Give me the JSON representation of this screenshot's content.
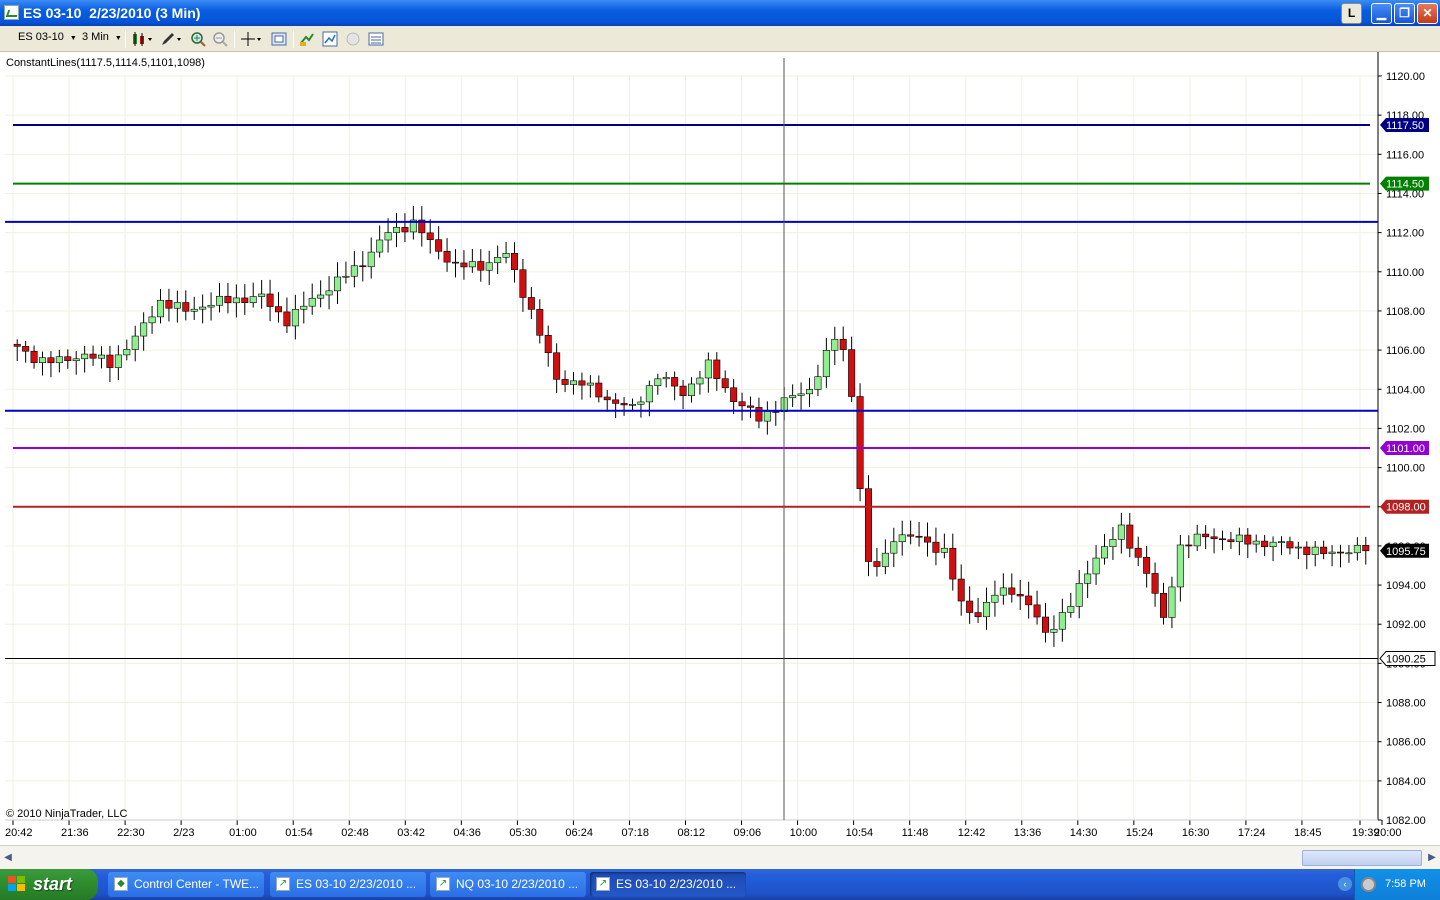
{
  "window": {
    "title": "ES 03-10  2/23/2010 (3 Min)",
    "buttons": {
      "layout": "L"
    }
  },
  "toolbar": {
    "instrument": "ES 03-10",
    "interval": "3 Min",
    "tools": [
      "candlestick-icon",
      "pencil-icon",
      "zoom-in-icon",
      "zoom-out-icon",
      "crosshair-icon",
      "properties-icon",
      "strategy-icon",
      "indicator-icon",
      "circle-icon",
      "data-box-icon"
    ]
  },
  "chart": {
    "indicator_label": "ConstantLines(1117.5,1114.5,1101,1098)",
    "copyright": "© 2010 NinjaTrader, LLC",
    "colors": {
      "up": "#90ee90",
      "down": "#d01010",
      "wick": "#000000"
    },
    "chart_data": {
      "type": "candlestick",
      "instrument": "ES 03-10",
      "interval": "3 Min",
      "ylim": [
        1082,
        1121
      ],
      "y_ticks": [
        "1120.00",
        "1118.00",
        "1116.00",
        "1114.00",
        "1112.00",
        "1110.00",
        "1108.00",
        "1106.00",
        "1104.00",
        "1102.00",
        "1100.00",
        "1098.00",
        "1096.00",
        "1094.00",
        "1092.00",
        "1090.00",
        "1088.00",
        "1086.00",
        "1084.00",
        "1082.00"
      ],
      "x_ticks": [
        "20:42",
        "21:36",
        "22:30",
        "2/23",
        "01:00",
        "01:54",
        "02:48",
        "03:42",
        "04:36",
        "05:30",
        "06:24",
        "07:18",
        "08:12",
        "09:06",
        "10:00",
        "10:54",
        "11:48",
        "12:42",
        "13:36",
        "14:30",
        "15:24",
        "16:30",
        "17:24",
        "18:45",
        "19:39",
        "20:00"
      ],
      "price_path": [
        [
          0,
          1106.3
        ],
        [
          3,
          1105.6
        ],
        [
          6,
          1105.4
        ],
        [
          9,
          1105.8
        ],
        [
          12,
          1105.3
        ],
        [
          15,
          1106.6
        ],
        [
          18,
          1108.5
        ],
        [
          21,
          1108.0
        ],
        [
          24,
          1108.4
        ],
        [
          27,
          1108.6
        ],
        [
          30,
          1108.7
        ],
        [
          33,
          1107.5
        ],
        [
          36,
          1108.6
        ],
        [
          39,
          1109.5
        ],
        [
          42,
          1110.5
        ],
        [
          45,
          1112.0
        ],
        [
          48,
          1112.5
        ],
        [
          50,
          1111.5
        ],
        [
          53,
          1110.3
        ],
        [
          56,
          1110.3
        ],
        [
          59,
          1110.9
        ],
        [
          62,
          1108.0
        ],
        [
          65,
          1104.5
        ],
        [
          68,
          1104.3
        ],
        [
          71,
          1103.5
        ],
        [
          74,
          1103.0
        ],
        [
          77,
          1104.7
        ],
        [
          80,
          1103.8
        ],
        [
          83,
          1105.2
        ],
        [
          86,
          1103.5
        ],
        [
          89,
          1102.5
        ],
        [
          92,
          1103.4
        ],
        [
          95,
          1104.0
        ],
        [
          98,
          1106.6
        ],
        [
          99.5,
          1105.6
        ],
        [
          100.5,
          1102.0
        ],
        [
          101,
          1099.0
        ],
        [
          102,
          1095.0
        ],
        [
          103.5,
          1095.0
        ],
        [
          105,
          1096.5
        ],
        [
          108,
          1096.4
        ],
        [
          111,
          1095.7
        ],
        [
          113,
          1093.0
        ],
        [
          115,
          1092.5
        ],
        [
          117,
          1093.5
        ],
        [
          119,
          1093.8
        ],
        [
          121,
          1093.0
        ],
        [
          123,
          1091.5
        ],
        [
          126,
          1093.0
        ],
        [
          129,
          1095.5
        ],
        [
          132,
          1096.8
        ],
        [
          135,
          1094.7
        ],
        [
          137,
          1092.2
        ],
        [
          139,
          1096.0
        ],
        [
          142,
          1096.5
        ],
        [
          145,
          1096.3
        ],
        [
          148,
          1096.2
        ],
        [
          152,
          1096.0
        ],
        [
          156,
          1095.6
        ],
        [
          159,
          1095.8
        ],
        [
          161,
          1095.75
        ]
      ],
      "candle_count": 161,
      "constant_lines": [
        {
          "value": 1117.5,
          "label": "1117.50",
          "color": "#000080"
        },
        {
          "value": 1114.5,
          "label": "1114.50",
          "color": "#008000"
        },
        {
          "value": 1101.0,
          "label": "1101.00",
          "color": "#9400d3"
        },
        {
          "value": 1098.0,
          "label": "1098.00",
          "color": "#b22222"
        }
      ],
      "drawn_lines": [
        {
          "value": 1112.55,
          "color": "#0000cd"
        },
        {
          "value": 1102.9,
          "color": "#0000cd"
        }
      ],
      "last_price": {
        "value": 1095.75,
        "label": "1095.75"
      },
      "cursor": {
        "price": 1090.25,
        "label": "1090.25",
        "time": "09:42"
      }
    }
  },
  "scrollbar": {
    "left_arrow": "◀",
    "right_arrow": "▶"
  },
  "taskbar": {
    "start_label": "start",
    "tasks": [
      {
        "label": "Control Center - TWE...",
        "active": false
      },
      {
        "label": "ES 03-10  2/23/2010 ...",
        "active": false
      },
      {
        "label": "NQ 03-10  2/23/2010 ...",
        "active": false
      },
      {
        "label": "ES 03-10  2/23/2010 ...",
        "active": true
      }
    ],
    "clock": "7:58 PM"
  }
}
